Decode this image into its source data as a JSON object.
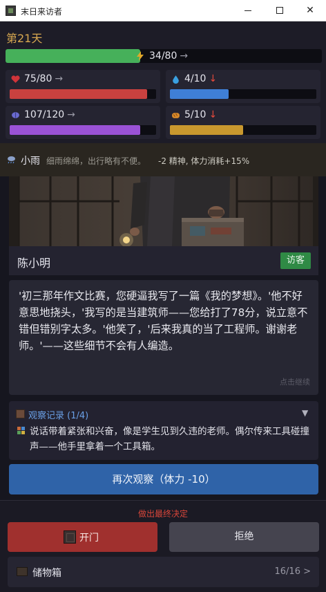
{
  "window": {
    "title": "末日来访者",
    "minimize_icon": "minimize-icon",
    "maximize_icon": "maximize-icon",
    "close_icon": "close-icon",
    "close_glyph": "✕"
  },
  "header": {
    "day": "第21天",
    "energy": {
      "text": "34/80",
      "trend": "→",
      "fraction": 0.425,
      "color": "#46b05a",
      "icon": "lightning-icon"
    },
    "stats": [
      {
        "id": "health",
        "icon": "heart-icon",
        "text": "75/80",
        "trend": "→",
        "fraction": 0.9375,
        "color": "#c9413f"
      },
      {
        "id": "water",
        "icon": "water-drop-icon",
        "text": "4/10",
        "trend": "↓",
        "fraction": 0.4,
        "color": "#3f7fd6"
      },
      {
        "id": "sanity",
        "icon": "brain-icon",
        "text": "107/120",
        "trend": "→",
        "fraction": 0.892,
        "color": "#9a52d6"
      },
      {
        "id": "food",
        "icon": "bread-icon",
        "text": "5/10",
        "trend": "↓",
        "fraction": 0.5,
        "color": "#c9982e"
      }
    ]
  },
  "weather": {
    "icon": "rain-cloud-icon",
    "name": "小雨",
    "description": "细雨绵绵，出行略有不便。",
    "effect": "-2 精神, 体力消耗+15%"
  },
  "visitor": {
    "name": "陈小明",
    "tag": "访客",
    "dialogue": "'初三那年作文比赛，您硬逼我写了一篇《我的梦想》。'他不好意思地挠头，'我写的是当建筑师——您给打了78分，说立意不错但错别字太多。'他笑了，'后来我真的当了工程师。谢谢老师。'——这些细节不会有人编造。",
    "continue_hint": "点击继续"
  },
  "observation": {
    "title": "观察记录 (1/4)",
    "chevron": "▼",
    "text": "说话带着紧张和兴奋，像是学生见到久违的老师。偶尔传来工具碰撞声——他手里拿着一个工具箱。"
  },
  "actions": {
    "observe_again": "再次观察（体力 -10）",
    "decision_label": "做出最终决定",
    "open_door": "开门",
    "refuse": "拒绝"
  },
  "storage": {
    "label": "储物箱",
    "count": "16/16 >"
  }
}
